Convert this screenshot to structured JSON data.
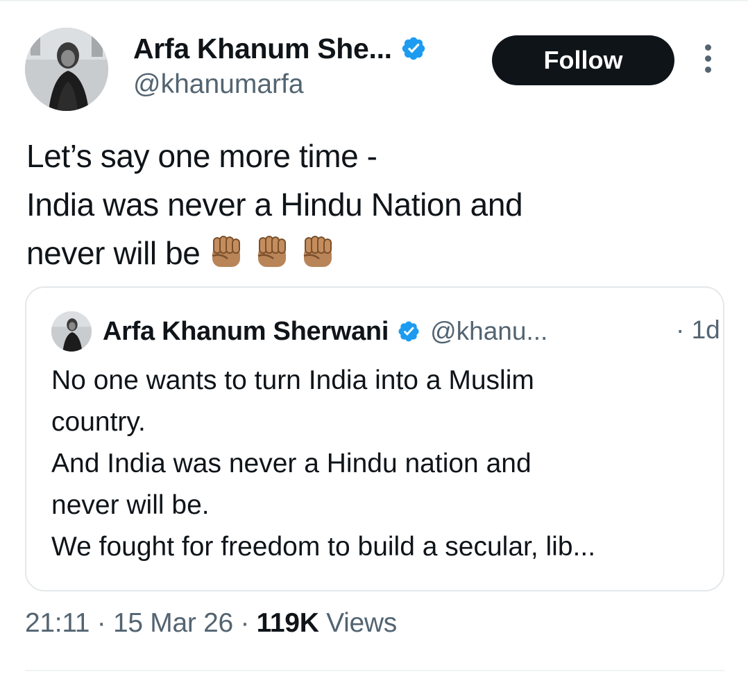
{
  "tweet": {
    "author": {
      "display_name": "Arfa Khanum She...",
      "handle": "@khanumarfa",
      "verified": true,
      "avatar_icon": "profile-photo"
    },
    "follow_label": "Follow",
    "more_icon": "more-vertical-icon",
    "text_lines": [
      "Let’s say one more time -",
      "India was never a Hindu Nation and",
      "never will be"
    ],
    "emoji": [
      "✊🏽",
      "✊🏽",
      "✊🏽"
    ],
    "quoted": {
      "display_name": "Arfa Khanum Sherwani",
      "handle": "@khanu...",
      "verified": true,
      "time": "· 1d",
      "text_lines": [
        "No one wants to turn India into a Muslim",
        "country.",
        "And India was never a Hindu nation and",
        "never will be.",
        "We fought for freedom to build a secular, lib..."
      ]
    },
    "meta": {
      "time": "21:11",
      "separator": "·",
      "date": "15 Mar 26",
      "views_count": "119K",
      "views_label": "Views"
    }
  },
  "colors": {
    "text_primary": "#0f1419",
    "text_secondary": "#536471",
    "verified_blue": "#1d9bf0",
    "border": "#e4e8ea",
    "fist_skin": "#b98458"
  }
}
